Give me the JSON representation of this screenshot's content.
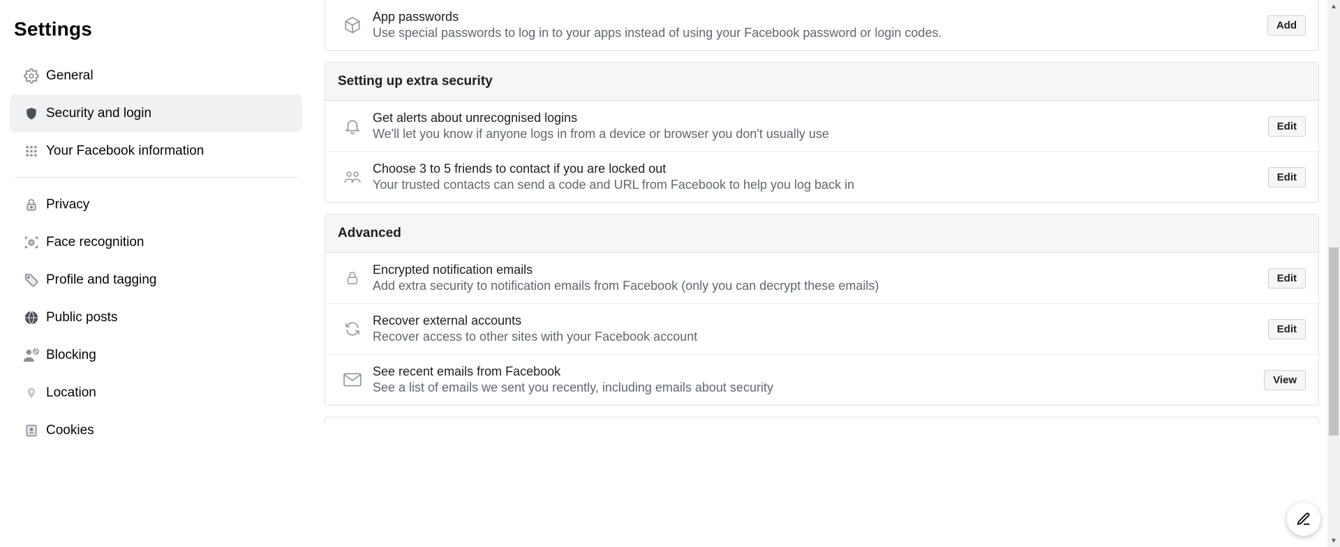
{
  "sidebar": {
    "title": "Settings",
    "items": [
      {
        "label": "General"
      },
      {
        "label": "Security and login"
      },
      {
        "label": "Your Facebook information"
      },
      {
        "label": "Privacy"
      },
      {
        "label": "Face recognition"
      },
      {
        "label": "Profile and tagging"
      },
      {
        "label": "Public posts"
      },
      {
        "label": "Blocking"
      },
      {
        "label": "Location"
      },
      {
        "label": "Cookies"
      }
    ]
  },
  "preRow": {
    "title": "App passwords",
    "desc": "Use special passwords to log in to your apps instead of using your Facebook password or login codes.",
    "action": "Add"
  },
  "sections": [
    {
      "header": "Setting up extra security",
      "rows": [
        {
          "title": "Get alerts about unrecognised logins",
          "desc": "We'll let you know if anyone logs in from a device or browser you don't usually use",
          "action": "Edit"
        },
        {
          "title": "Choose 3 to 5 friends to contact if you are locked out",
          "desc": "Your trusted contacts can send a code and URL from Facebook to help you log back in",
          "action": "Edit"
        }
      ]
    },
    {
      "header": "Advanced",
      "rows": [
        {
          "title": "Encrypted notification emails",
          "desc": "Add extra security to notification emails from Facebook (only you can decrypt these emails)",
          "action": "Edit"
        },
        {
          "title": "Recover external accounts",
          "desc": "Recover access to other sites with your Facebook account",
          "action": "Edit"
        },
        {
          "title": "See recent emails from Facebook",
          "desc": "See a list of emails we sent you recently, including emails about security",
          "action": "View"
        }
      ]
    }
  ]
}
